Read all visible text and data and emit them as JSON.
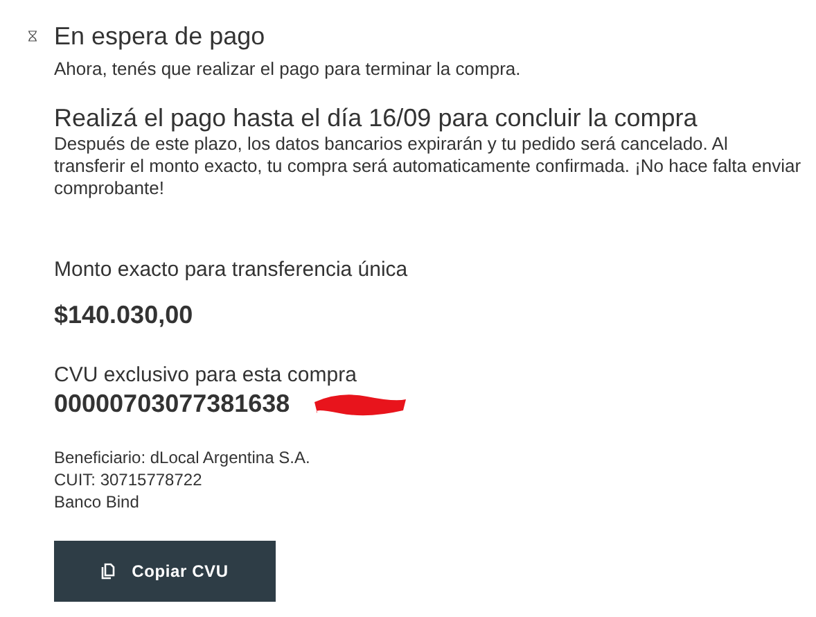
{
  "status": {
    "title": "En espera de pago",
    "subtitle": "Ahora, tenés que realizar el pago para terminar la compra."
  },
  "deadline": {
    "heading": "Realizá el pago hasta el día 16/09 para concluir la compra",
    "body": "Después de este plazo, los datos bancarios expirarán y tu pedido será cancelado. Al transferir el monto exacto, tu compra será automaticamente confirmada. ¡No hace falta enviar comprobante!"
  },
  "amount": {
    "label": "Monto exacto para transferencia única",
    "value": "$140.030,00"
  },
  "cvu": {
    "label": "CVU exclusivo para esta compra",
    "value": "00000703077381638"
  },
  "details": [
    "Beneficiario: dLocal Argentina S.A.",
    "CUIT: 30715778722",
    "Banco Bind"
  ],
  "button": {
    "label": "Copiar CVU"
  }
}
